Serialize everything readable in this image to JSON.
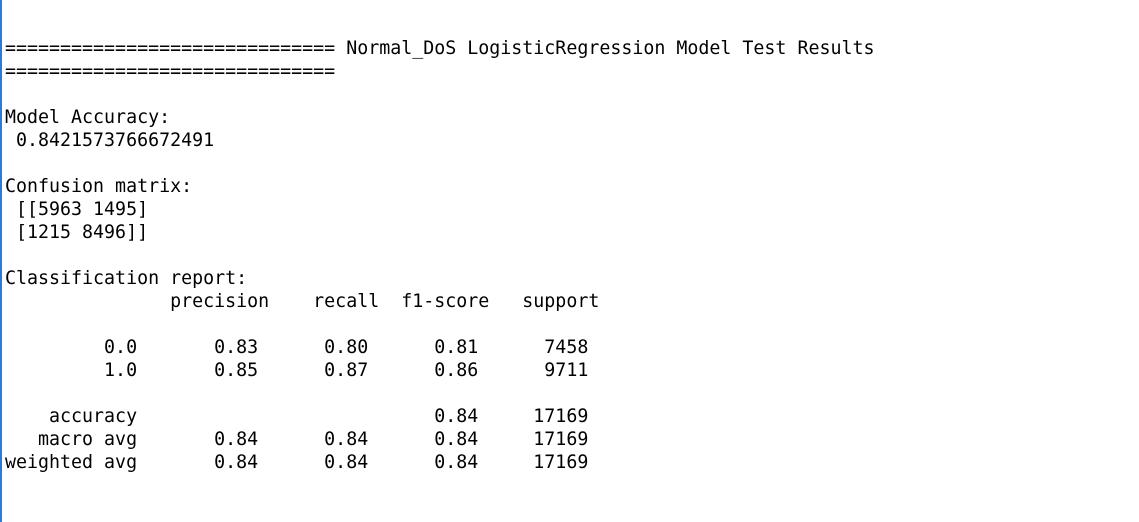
{
  "output": {
    "lines": [
      "============================== Normal_DoS LogisticRegression Model Test Results",
      "==============================",
      "",
      "Model Accuracy:",
      " 0.8421573766672491",
      "",
      "Confusion matrix:",
      " [[5963 1495]",
      " [1215 8496]]",
      "",
      "Classification report:",
      "               precision    recall  f1-score   support",
      "",
      "         0.0       0.83      0.80      0.81      7458",
      "         1.0       0.85      0.87      0.86      9711",
      "",
      "    accuracy                           0.84     17169",
      "   macro avg       0.84      0.84      0.84     17169",
      "weighted avg       0.84      0.84      0.84     17169"
    ]
  }
}
